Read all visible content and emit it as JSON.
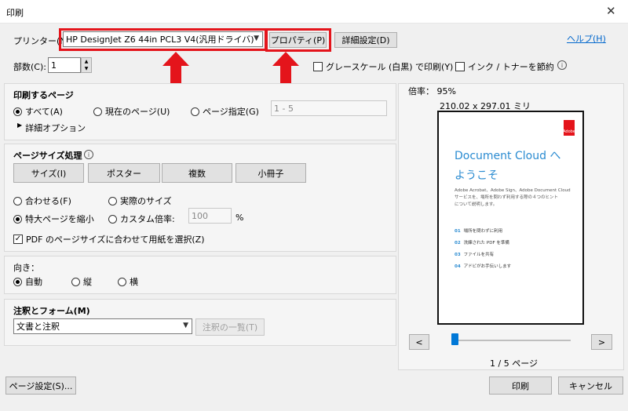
{
  "window": {
    "title": "印刷"
  },
  "printer": {
    "label": "プリンター(N):",
    "selected": "HP DesignJet Z6 44in PCL3 V4(汎用ドライバ)",
    "properties_button": "プロパティ(P)",
    "advanced_button": "詳細設定(D)",
    "help_link": "ヘルプ(H)",
    "copies_label": "部数(C):",
    "copies_value": "1",
    "grayscale_label": "グレースケール (白黒) で印刷(Y)",
    "ink_save_label": "インク / トナーを節約"
  },
  "pages_to_print": {
    "title": "印刷するページ",
    "all": "すべて(A)",
    "current": "現在のページ(U)",
    "specify": "ページ指定(G)",
    "range_value": "1 - 5",
    "more_options": "詳細オプション"
  },
  "page_sizing": {
    "title": "ページサイズ処理",
    "buttons": [
      "サイズ(I)",
      "ポスター",
      "複数",
      "小冊子"
    ],
    "fit": "合わせる(F)",
    "actual": "実際のサイズ",
    "shrink": "特大ページを縮小",
    "custom": "カスタム倍率:",
    "custom_value": "100",
    "percent": "%",
    "choose_paper": "PDF のページサイズに合わせて用紙を選択(Z)"
  },
  "orientation": {
    "title": "向き：",
    "auto": "自動",
    "portrait": "縦",
    "landscape": "横"
  },
  "comments": {
    "title": "注釈とフォーム(M)",
    "selected": "文書と注釈",
    "summarize": "注釈の一覧(T)"
  },
  "preview": {
    "scale": "倍率： 95%",
    "size": "210.02 x 297.01 ミリ",
    "doc_title_1": "Document Cloud へ",
    "doc_title_2": "ようこそ",
    "doc_body_1": "Adobe Acrobat、Adobe Sign、Adobe Document Cloud",
    "doc_body_2": "サービスを、場所を問わず利用する際の４つのヒント",
    "doc_body_3": "について説明します。",
    "doc_items": [
      {
        "num": "01",
        "text": "場所を問わずに利用"
      },
      {
        "num": "02",
        "text": "洗練された PDF を準備"
      },
      {
        "num": "03",
        "text": "ファイルを共有"
      },
      {
        "num": "04",
        "text": "アドビがお手伝いします"
      }
    ],
    "adobe_logo_text": "Adobe",
    "prev": "<",
    "next": ">",
    "page_indicator": "1 / 5 ページ",
    "page_progress": 0.0
  },
  "footer": {
    "page_setup": "ページ設定(S)...",
    "print": "印刷",
    "cancel": "キャンセル"
  },
  "colors": {
    "highlight": "#e4141b",
    "link": "#0066cc",
    "doc_blue": "#2a8bd1"
  }
}
